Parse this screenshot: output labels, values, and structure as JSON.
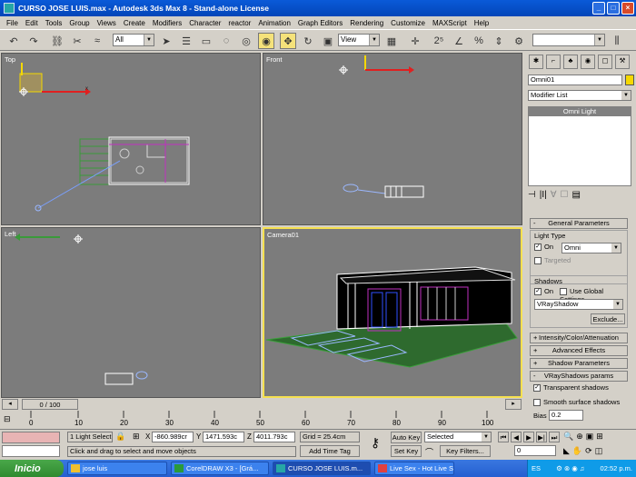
{
  "window": {
    "title": "CURSO JOSE LUIS.max - Autodesk 3ds Max 8  - Stand-alone License",
    "min": "_",
    "max": "□",
    "close": "×"
  },
  "menu": [
    "File",
    "Edit",
    "Tools",
    "Group",
    "Views",
    "Create",
    "Modifiers",
    "Character",
    "reactor",
    "Animation",
    "Graph Editors",
    "Rendering",
    "Customize",
    "MAXScript",
    "Help"
  ],
  "toolbar": {
    "selection_filter": "All",
    "ref_coord": "View",
    "named_sel": ""
  },
  "viewports": {
    "top": "Top",
    "front": "Front",
    "left": "Left",
    "camera": "Camera01"
  },
  "command_panel": {
    "object_name": "Omni01",
    "color": "#f5d800",
    "modifier_list": "Modifier List",
    "stack_item": "Omni Light",
    "general_params": "General Parameters",
    "light_type_group": "Light Type",
    "on_label": "On",
    "light_type_value": "Omni",
    "targeted_label": "Targeted",
    "shadows_group": "Shadows",
    "shadows_on_label": "On",
    "use_global_label": "Use Global Settings",
    "shadow_type": "VRayShadow",
    "exclude_button": "Exclude...",
    "rollout_intensity": "Intensity/Color/Attenuation",
    "rollout_advanced": "Advanced Effects",
    "rollout_shadow_params": "Shadow Parameters",
    "rollout_vray": "VRayShadows params",
    "transparent_shadows": "Transparent shadows",
    "smooth_surface": "Smooth surface shadows",
    "bias_label": "Bias",
    "bias_value": "0.2"
  },
  "timeline": {
    "frame": "0 / 100",
    "ticks": [
      "0",
      "10",
      "20",
      "30",
      "40",
      "50",
      "60",
      "70",
      "80",
      "90",
      "100"
    ]
  },
  "status": {
    "selection": "1 Light Select",
    "x_label": "X",
    "x_value": "-860.989cr",
    "y_label": "Y",
    "y_value": "1471.593c",
    "z_label": "Z",
    "z_value": "4011.793c",
    "grid": "Grid = 25.4cm",
    "prompt": "Click and drag to select and move objects",
    "add_time_tag": "Add Time Tag",
    "auto_key": "Auto Key",
    "set_key": "Set Key",
    "key_mode": "Selected",
    "key_filters": "Key Filters...",
    "current_frame": "0"
  },
  "taskbar": {
    "start": "Inicio",
    "items": [
      "jose luis",
      "CorelDRAW X3 - [Grá...",
      "CURSO JOSE LUIS.m...",
      "Live Sex - Hot Live Se..."
    ],
    "lang": "ES",
    "clock": "02:52 p.m."
  }
}
